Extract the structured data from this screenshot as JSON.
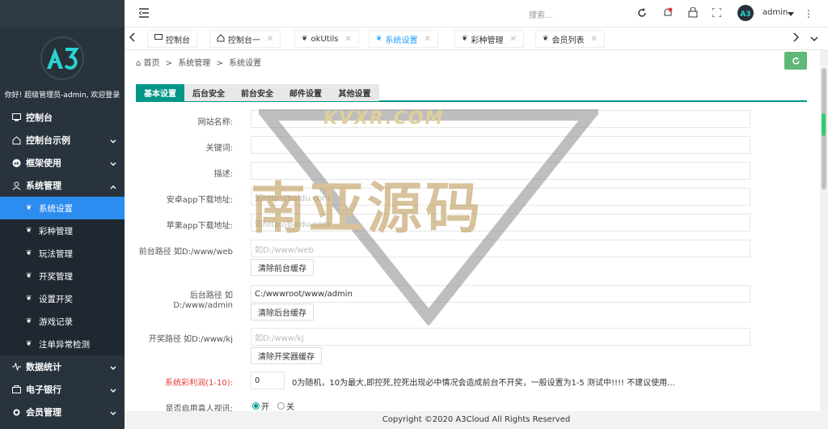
{
  "sidebar": {
    "welcome": "你好! 超级管理员-admin, 欢迎登录",
    "logo_text": "A3",
    "items": [
      {
        "label": "控制台"
      },
      {
        "label": "控制台示例"
      },
      {
        "label": "框架使用"
      },
      {
        "label": "系统管理"
      }
    ],
    "sub_items": [
      {
        "label": "系统设置"
      },
      {
        "label": "彩种管理"
      },
      {
        "label": "玩法管理"
      },
      {
        "label": "开奖管理"
      },
      {
        "label": "设置开奖"
      },
      {
        "label": "游戏记录"
      },
      {
        "label": "注单异常检测"
      }
    ],
    "bottom_items": [
      {
        "label": "数据统计"
      },
      {
        "label": "电子银行"
      },
      {
        "label": "会员管理"
      }
    ]
  },
  "header": {
    "search_placeholder": "搜索...",
    "user": "admin"
  },
  "tabs": [
    {
      "label": "控制台"
    },
    {
      "label": "控制台一"
    },
    {
      "label": "okUtils"
    },
    {
      "label": "系统设置"
    },
    {
      "label": "彩种管理"
    },
    {
      "label": "会员列表"
    }
  ],
  "breadcrumb": {
    "home": "首页",
    "sep1": ">",
    "level1": "系统管理",
    "sep2": ">",
    "level2": "系统设置"
  },
  "content_tabs": [
    {
      "label": "基本设置"
    },
    {
      "label": "后台安全"
    },
    {
      "label": "前台安全"
    },
    {
      "label": "邮件设置"
    },
    {
      "label": "其他设置"
    }
  ],
  "form": {
    "site_name": {
      "label": "网站名称:",
      "value": ""
    },
    "keywords": {
      "label": "关键词:",
      "value": ""
    },
    "description": {
      "label": "描述:",
      "value": ""
    },
    "android": {
      "label": "安卓app下载地址:",
      "placeholder": "如http://baidu.com"
    },
    "ios": {
      "label": "苹果app下载地址:",
      "placeholder": "如http://baidu.com"
    },
    "front_path": {
      "label": "前台路径 如D:/www/web",
      "placeholder": "如D:/www/web",
      "button": "清除前台缓存"
    },
    "admin_path": {
      "label1": "后台路径 如",
      "label2": "D:/www/admin",
      "value": "C:/wwwroot/www/admin",
      "button": "清除后台缓存"
    },
    "lottery_path": {
      "label": "开奖路径 如D:/www/kj",
      "placeholder": "如D:/www/kj",
      "button": "清除开奖器缓存"
    },
    "profit": {
      "label": "系统彩利润(1-10):",
      "value": "0",
      "hint": "0为随机，10为最大,即控死,控死出现必中情况会造成前台不开奖，一般设置为1-5 测试中!!!! 不建议使用..."
    },
    "real": {
      "label": "是否启用真人视讯:",
      "on": "开",
      "off": "关"
    }
  },
  "watermark": {
    "top": "KVXR.COM",
    "main": "南亚源码"
  },
  "footer": "Copyright ©2020 A3Cloud All Rights Reserved",
  "colors": {
    "sidebar": "#28333e",
    "accent": "#009688",
    "active_sub": "#2d8cf0",
    "refresh": "#5fb878"
  }
}
